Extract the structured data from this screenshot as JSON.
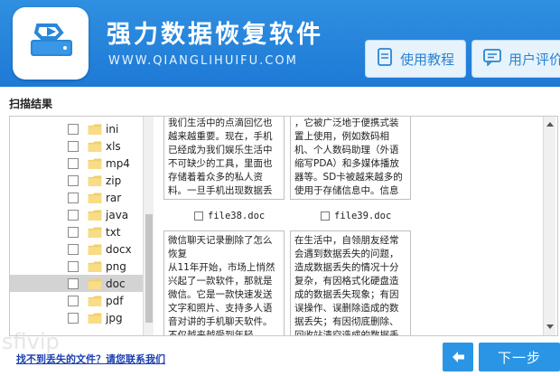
{
  "header": {
    "title": "强力数据恢复软件",
    "subtitle": "WWW.QIANGLIHUIFU.COM",
    "btn_tutorial": "使用教程",
    "btn_review": "用户评价"
  },
  "scan_label": "扫描结果",
  "tree": {
    "items": [
      {
        "label": "ini"
      },
      {
        "label": "xls"
      },
      {
        "label": "mp4"
      },
      {
        "label": "zip"
      },
      {
        "label": "rar"
      },
      {
        "label": "java"
      },
      {
        "label": "txt"
      },
      {
        "label": "docx"
      },
      {
        "label": "png"
      },
      {
        "label": "doc",
        "selected": true
      },
      {
        "label": "pdf"
      },
      {
        "label": "jpg"
      }
    ]
  },
  "preview": {
    "cards": [
      {
        "text": "我们生活中的点滴回忆也越来越重要。现在，手机已经成为我们娱乐生活中不可缺少的工具，里面也存储着着众多的私人资料。一旦手机出现数据丢失，因为担心数据的安",
        "caption": "file38.doc"
      },
      {
        "text": "，它被广泛地于便携式装置上使用，例如数码相机、个人数码助理（外语缩写PDA）和多媒体播放器等。SD卡被越来越多的使用于存储信息中。信息越多，数据的安全风险越",
        "caption": "file39.doc"
      },
      {
        "text": "微信聊天记录删除了怎么恢复\n从11年开始，市场上悄然兴起了一款软件，那就是微信。它是一款快速发送文字和照片、支持多人语音对讲的手机聊天软件。不仅越来越受到年轻",
        "caption": ""
      },
      {
        "text": "在生活中，自领朋友经常会遇到数据丢失的问题，造成数据丢失的情况十分复杂，有因格式化硬盘造成的数据丢失现象；有因误操作、误删除造成的数据丢失；有因彻底删除、回收站清空造成的数据丢失",
        "caption": ""
      }
    ]
  },
  "help_link": "找不到丢失的文件？请您联系我们",
  "next_label": "下一步",
  "watermark": "sfivip",
  "colors": {
    "header_blue": "#2284da",
    "button_blue": "#2b95e5"
  }
}
